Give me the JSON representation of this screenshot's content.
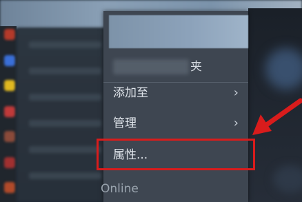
{
  "menu": {
    "blurred_item_suffix": "夹",
    "items": [
      {
        "label": "添加至",
        "has_submenu": true
      },
      {
        "label": "管理",
        "has_submenu": true
      },
      {
        "label": "属性...",
        "has_submenu": false,
        "highlighted": true
      }
    ],
    "chevron_glyph": "›"
  },
  "status": {
    "bottom_text": "Online"
  },
  "colors": {
    "annotation_red": "#d91c1c",
    "menu_bg": "#3e4651",
    "menu_text": "#dfe4ea"
  },
  "icons": [
    "chevron-right-icon",
    "red-arrow-icon"
  ]
}
